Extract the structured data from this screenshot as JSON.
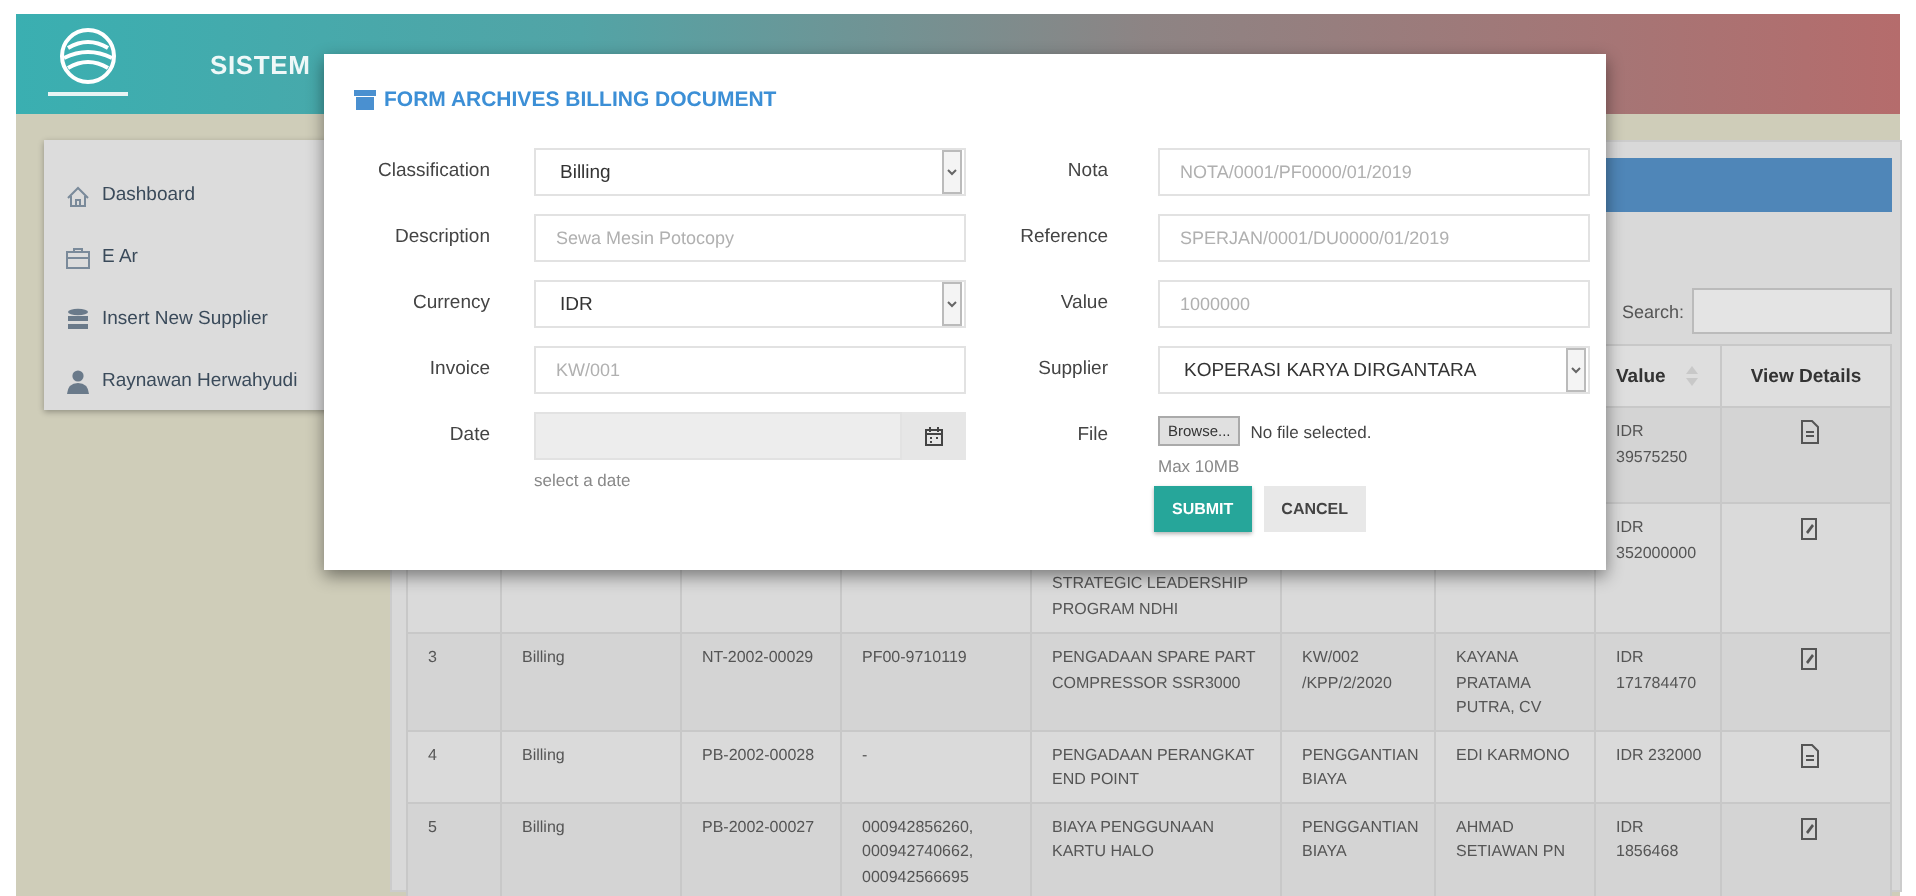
{
  "header": {
    "title": "SISTEM"
  },
  "sidebar": {
    "items": [
      {
        "label": "Dashboard"
      },
      {
        "label": "E Ar"
      },
      {
        "label": "Insert New Supplier"
      },
      {
        "label": "Raynawan Herwahyudi"
      }
    ]
  },
  "table": {
    "search_label": "Search:",
    "columns": [
      {
        "label": "Value",
        "sortable": true
      },
      {
        "label": "View Details",
        "sortable": false
      }
    ],
    "rows": [
      {
        "value": "IDR 39575250",
        "kind": "document"
      },
      {
        "description": "STRATEGIC LEADERSHIP PROGRAM NDHI",
        "value": "IDR 352000000",
        "kind": "form"
      },
      {
        "no": "3",
        "classification": "Billing",
        "nota": "NT-2002-00029",
        "reference": "PF00-9710119",
        "description": "PENGADAAN SPARE PART COMPRESSOR SSR3000",
        "invoice": "KW/002 /KPP/2/2020",
        "supplier": "KAYANA PRATAMA PUTRA, CV",
        "value": "IDR 171784470",
        "kind": "form"
      },
      {
        "no": "4",
        "classification": "Billing",
        "nota": "PB-2002-00028",
        "reference": "-",
        "description": "PENGADAAN PERANGKAT END POINT",
        "invoice": "PENGGANTIAN BIAYA",
        "supplier": "EDI KARMONO",
        "value": "IDR 232000",
        "kind": "document"
      },
      {
        "no": "5",
        "classification": "Billing",
        "nota": "PB-2002-00027",
        "reference": "000942856260, 000942740662, 000942566695",
        "description": "BIAYA PENGGUNAAN KARTU HALO",
        "invoice": "PENGGANTIAN BIAYA",
        "supplier": "AHMAD SETIAWAN PN",
        "value": "IDR 1856468",
        "kind": "form"
      }
    ]
  },
  "modal": {
    "title": "FORM ARCHIVES BILLING DOCUMENT",
    "left": [
      {
        "label": "Classification",
        "kind": "select",
        "value": "Billing"
      },
      {
        "label": "Description",
        "kind": "text",
        "placeholder": "Sewa Mesin Potocopy"
      },
      {
        "label": "Currency",
        "kind": "select",
        "value": "IDR"
      },
      {
        "label": "Invoice",
        "kind": "text",
        "placeholder": "KW/001"
      },
      {
        "label": "Date",
        "kind": "date",
        "disabled": true,
        "help": "select a date"
      }
    ],
    "right": [
      {
        "label": "Nota",
        "kind": "text",
        "placeholder": "NOTA/0001/PF0000/01/2019"
      },
      {
        "label": "Reference",
        "kind": "text",
        "placeholder": "SPERJAN/0001/DU0000/01/2019"
      },
      {
        "label": "Value",
        "kind": "text",
        "placeholder": "1000000"
      },
      {
        "label": "Supplier",
        "kind": "select",
        "value": "KOPERASI KARYA DIRGANTARA"
      },
      {
        "label": "File",
        "kind": "file",
        "button": "Browse...",
        "status": "No file selected.",
        "help": "Max 10MB"
      }
    ],
    "buttons": [
      {
        "label": "SUBMIT",
        "kind": "primary"
      },
      {
        "label": "CANCEL",
        "kind": "secondary"
      }
    ]
  }
}
